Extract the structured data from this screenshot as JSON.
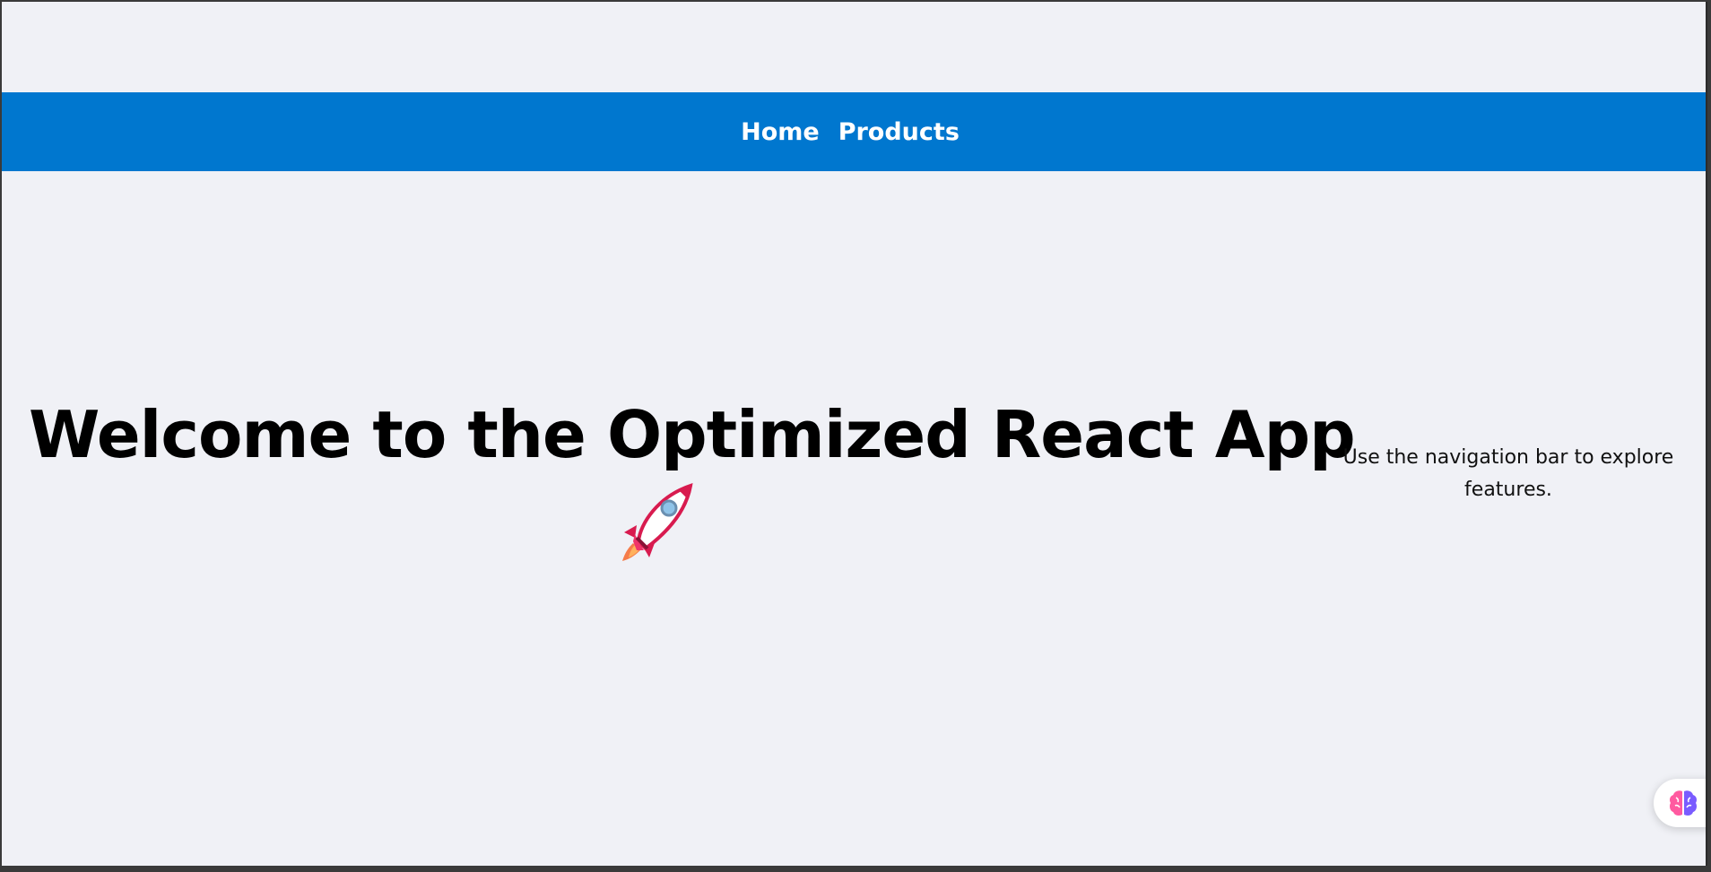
{
  "nav": {
    "links": [
      {
        "label": "Home"
      },
      {
        "label": "Products"
      }
    ],
    "background": "#0077cf"
  },
  "hero": {
    "title": "Welcome to the Optimized React App",
    "icon": "rocket-icon"
  },
  "side": {
    "text": "Use the navigation bar to explore features."
  },
  "fab": {
    "icon": "brain-icon"
  },
  "colors": {
    "page_background": "#f0f1f6",
    "nav_text": "#ffffff"
  }
}
